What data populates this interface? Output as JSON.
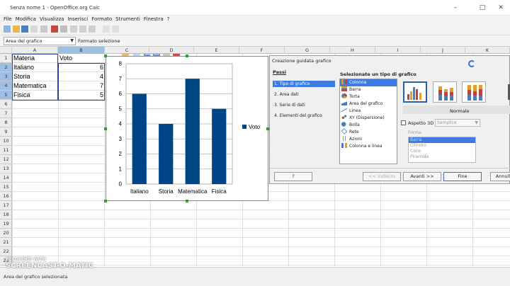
{
  "window": {
    "title": "Senza nome 1 - OpenOffice.org Calc"
  },
  "menu": [
    "File",
    "Modifica",
    "Visualizza",
    "Inserisci",
    "Formato",
    "Strumenti",
    "Finestra",
    "?"
  ],
  "namebox": {
    "value": "Area del grafico",
    "format_label": "Formato selezione"
  },
  "columns": [
    "A",
    "B",
    "C",
    "D",
    "E",
    "F",
    "G",
    "H",
    "I",
    "J",
    "K"
  ],
  "rows": [
    "1",
    "2",
    "3",
    "4",
    "5",
    "6",
    "7",
    "8",
    "9",
    "10",
    "11",
    "12",
    "13",
    "14",
    "15",
    "16",
    "17",
    "18",
    "19",
    "20",
    "21",
    "22",
    "23"
  ],
  "sheet": {
    "header": [
      "Materia",
      "Voto"
    ],
    "rows": [
      {
        "materia": "Italiano",
        "voto": "6"
      },
      {
        "materia": "Storia",
        "voto": "4"
      },
      {
        "materia": "Matematica",
        "voto": "7"
      },
      {
        "materia": "Fisica",
        "voto": "5"
      }
    ]
  },
  "chart_data": {
    "type": "bar",
    "categories": [
      "Italiano",
      "Storia",
      "Matematica",
      "Fisica"
    ],
    "series": [
      {
        "name": "Voto",
        "values": [
          6,
          4,
          7,
          5
        ],
        "color": "#004586"
      }
    ],
    "ylim": [
      0,
      8
    ],
    "yticks": [
      "0",
      "1",
      "2",
      "3",
      "4",
      "5",
      "6",
      "7",
      "8"
    ],
    "legend": "right",
    "grid": true
  },
  "dialog": {
    "title": "Creazione guidata grafico",
    "steps_header": "Passi",
    "steps": [
      "1. Tipo di grafico",
      "2. Area dati",
      "3. Serie di dati",
      "4. Elementi del grafico"
    ],
    "type_header": "Selezionate un tipo di grafico",
    "types": [
      "Colonna",
      "Barra",
      "Torta",
      "Area del grafico",
      "Linea",
      "XY (Dispersione)",
      "Bolla",
      "Rete",
      "Azioni",
      "Colonna e linea"
    ],
    "variant_label": "Normale",
    "aspect3d_label": "Aspetto 3D",
    "aspect3d_select": "Semplice",
    "form_label": "Forma",
    "forms": [
      "Barra",
      "Cilindro",
      "Cono",
      "Piramide"
    ],
    "buttons": {
      "help": "?",
      "back": "<< Indietro",
      "next": "Avanti >>",
      "finish": "Fine",
      "cancel": "Annulla"
    }
  },
  "status": {
    "text": "Area del grafico selezionata"
  },
  "watermark": {
    "line1": "RECORDED WITH",
    "line2": "SCREENCAST-O-MATIC"
  }
}
